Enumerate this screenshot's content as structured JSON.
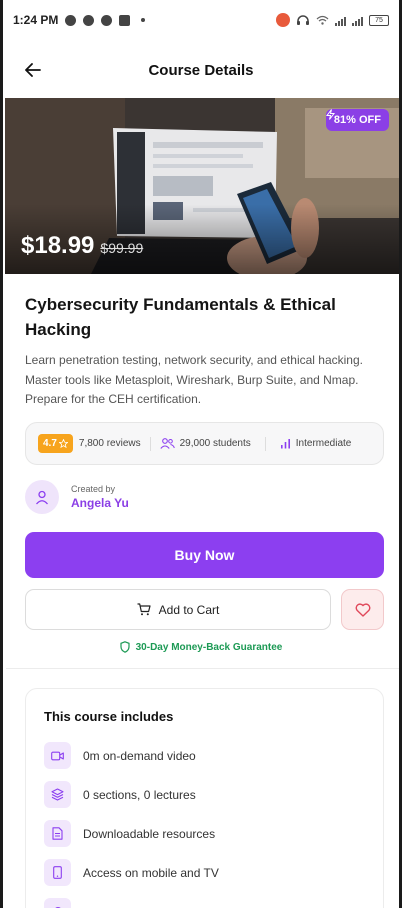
{
  "status_bar": {
    "time": "1:24 PM",
    "battery": "75"
  },
  "header": {
    "title": "Course Details"
  },
  "hero": {
    "discount": "81% OFF",
    "price": "$18.99",
    "original_price": "$99.99"
  },
  "course": {
    "title": "Cybersecurity Fundamentals & Ethical Hacking",
    "description": "Learn penetration testing, network security, and ethical hacking. Master tools like Metasploit, Wireshark, Burp Suite, and Nmap. Prepare for the CEH certification."
  },
  "stats": {
    "rating": "4.7",
    "reviews": "7,800 reviews",
    "students": "29,000 students",
    "level": "Intermediate"
  },
  "instructor": {
    "created_by_label": "Created by",
    "name": "Angela Yu"
  },
  "actions": {
    "buy_now": "Buy Now",
    "add_to_cart": "Add to Cart",
    "guarantee": "30-Day Money-Back Guarantee"
  },
  "includes": {
    "title": "This course includes",
    "items": [
      {
        "label": "0m on-demand video",
        "icon": "video-icon"
      },
      {
        "label": "0 sections, 0 lectures",
        "icon": "layers-icon"
      },
      {
        "label": "Downloadable resources",
        "icon": "file-icon"
      },
      {
        "label": "Access on mobile and TV",
        "icon": "mobile-icon"
      }
    ]
  },
  "colors": {
    "accent": "#8c3ff0",
    "rating": "#f7a41d",
    "guarantee": "#1d9a55",
    "wishlist": "#e0485a"
  }
}
